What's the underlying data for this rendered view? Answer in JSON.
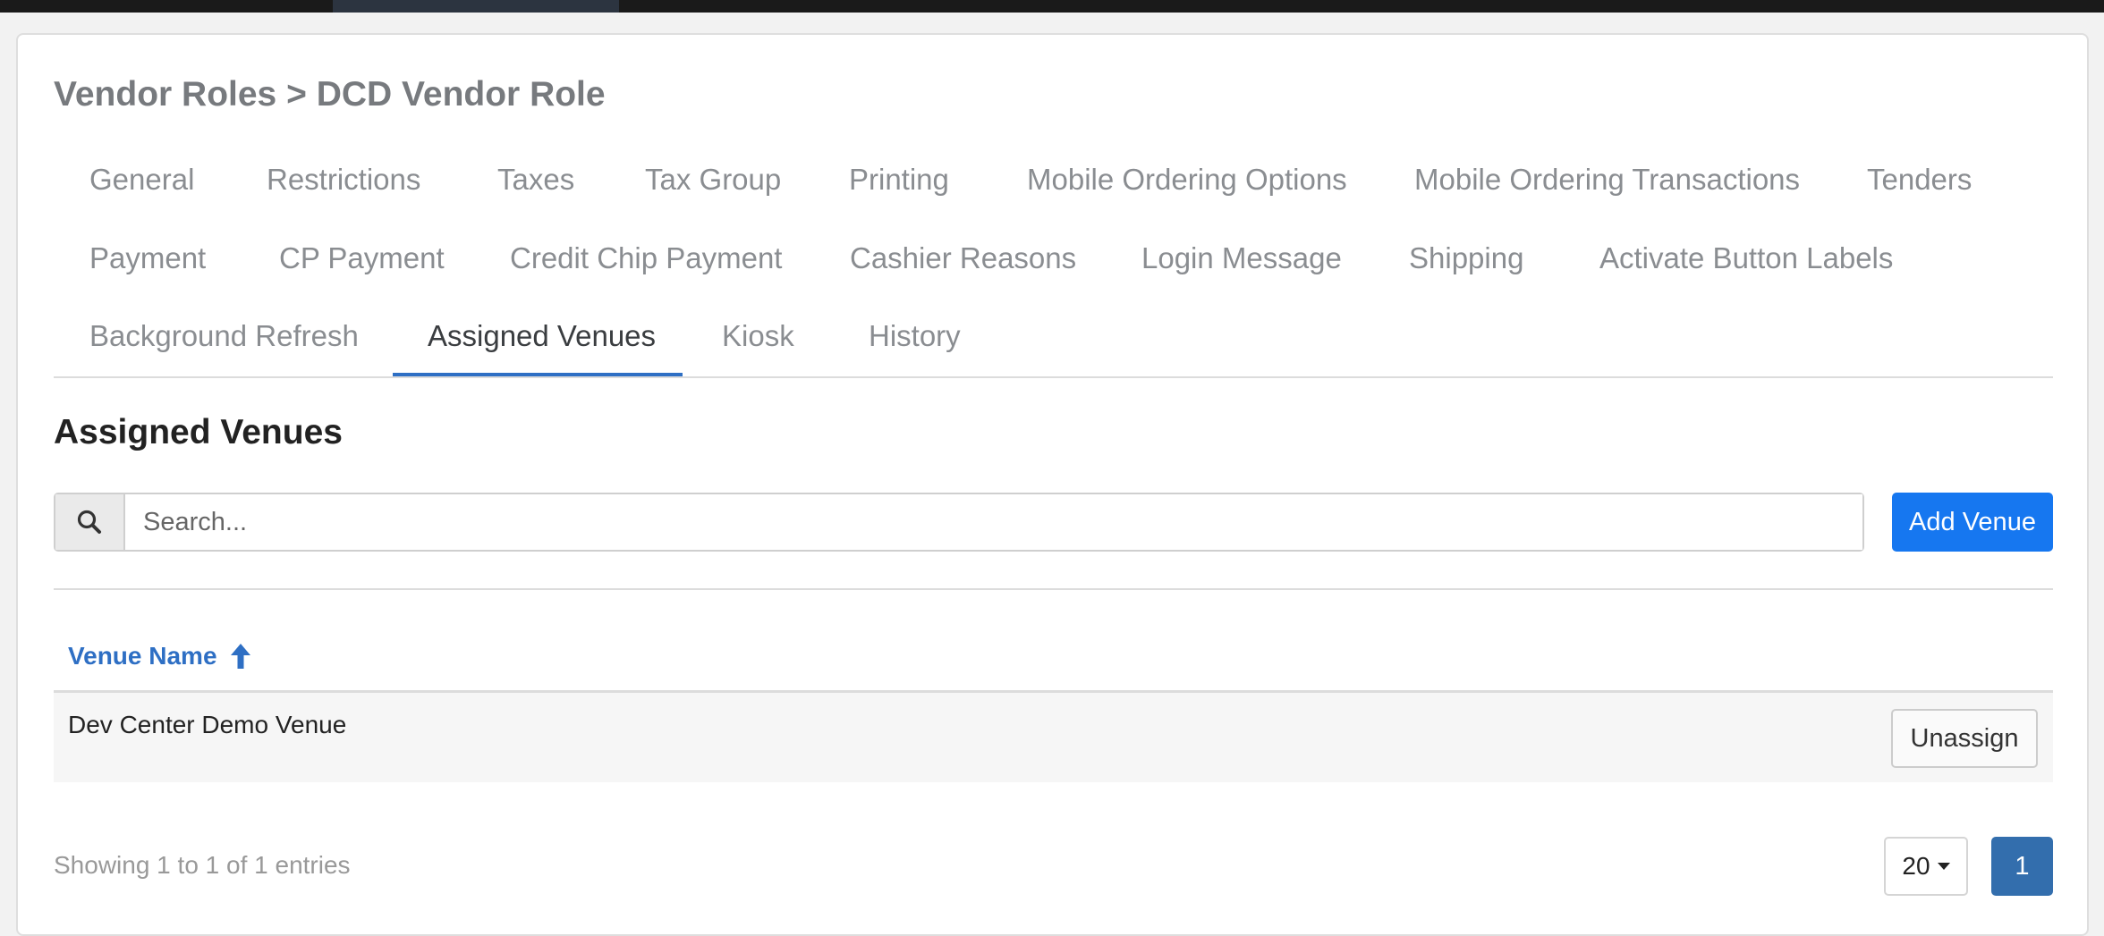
{
  "breadcrumb": {
    "parent": "Vendor Roles",
    "separator": ">",
    "current": "DCD Vendor Role"
  },
  "tabs": [
    {
      "label": "General"
    },
    {
      "label": "Restrictions"
    },
    {
      "label": "Taxes"
    },
    {
      "label": "Tax Group"
    },
    {
      "label": "Printing"
    },
    {
      "label": "Mobile Ordering Options"
    },
    {
      "label": "Mobile Ordering Transactions"
    },
    {
      "label": "Tenders"
    },
    {
      "label": "Payment"
    },
    {
      "label": "CP Payment"
    },
    {
      "label": "Credit Chip Payment"
    },
    {
      "label": "Cashier Reasons"
    },
    {
      "label": "Login Message"
    },
    {
      "label": "Shipping"
    },
    {
      "label": "Activate Button Labels"
    },
    {
      "label": "Background Refresh"
    },
    {
      "label": "Assigned Venues",
      "active": true
    },
    {
      "label": "Kiosk"
    },
    {
      "label": "History"
    }
  ],
  "section": {
    "title": "Assigned Venues"
  },
  "search": {
    "placeholder": "Search...",
    "value": ""
  },
  "actions": {
    "add_label": "Add Venue"
  },
  "table": {
    "columns": [
      {
        "label": "Venue Name",
        "sort": "ascending"
      }
    ],
    "rows": [
      {
        "venue_name": "Dev Center Demo Venue",
        "action_label": "Unassign"
      }
    ]
  },
  "footer": {
    "summary": "Showing 1 to 1 of 1 entries",
    "page_size": "20",
    "current_page": "1"
  },
  "colors": {
    "accent": "#2e6fc4",
    "primary_button": "#1677f0",
    "pagination_active": "#336ead"
  },
  "icons": {
    "search": "search-icon",
    "sort": "arrow-up-icon",
    "dropdown": "caret-down-icon"
  }
}
